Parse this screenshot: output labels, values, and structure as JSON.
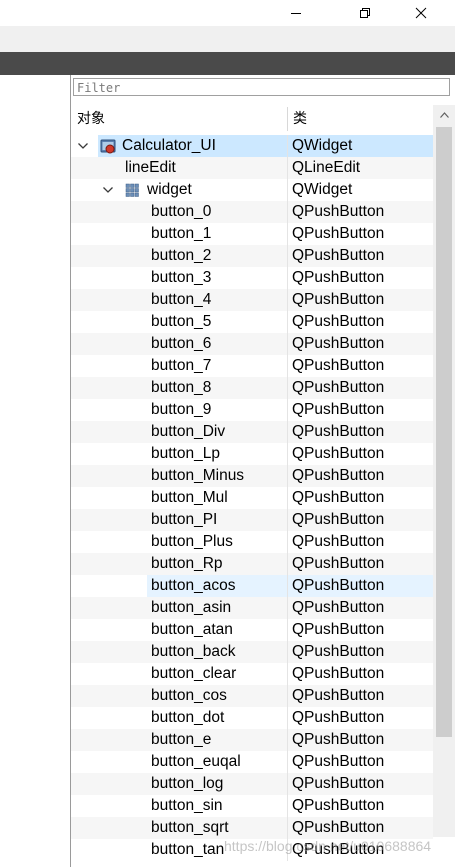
{
  "window": {
    "minimize_icon": "minimize-icon",
    "maximize_icon": "restore-icon",
    "close_icon": "close-icon"
  },
  "filter": {
    "placeholder": "Filter"
  },
  "tree": {
    "header": {
      "object": "对象",
      "class": "类"
    },
    "rows": [
      {
        "name": "Calculator_UI",
        "cls": "QWidget",
        "level": 0,
        "expanded": true,
        "icon": "widget-form-icon",
        "state": "selected"
      },
      {
        "name": "lineEdit",
        "cls": "QLineEdit",
        "level": 1
      },
      {
        "name": "widget",
        "cls": "QWidget",
        "level": 1,
        "expanded": true,
        "icon": "grid-layout-icon"
      },
      {
        "name": "button_0",
        "cls": "QPushButton",
        "level": 2
      },
      {
        "name": "button_1",
        "cls": "QPushButton",
        "level": 2
      },
      {
        "name": "button_2",
        "cls": "QPushButton",
        "level": 2
      },
      {
        "name": "button_3",
        "cls": "QPushButton",
        "level": 2
      },
      {
        "name": "button_4",
        "cls": "QPushButton",
        "level": 2
      },
      {
        "name": "button_5",
        "cls": "QPushButton",
        "level": 2
      },
      {
        "name": "button_6",
        "cls": "QPushButton",
        "level": 2
      },
      {
        "name": "button_7",
        "cls": "QPushButton",
        "level": 2
      },
      {
        "name": "button_8",
        "cls": "QPushButton",
        "level": 2
      },
      {
        "name": "button_9",
        "cls": "QPushButton",
        "level": 2
      },
      {
        "name": "button_Div",
        "cls": "QPushButton",
        "level": 2
      },
      {
        "name": "button_Lp",
        "cls": "QPushButton",
        "level": 2
      },
      {
        "name": "button_Minus",
        "cls": "QPushButton",
        "level": 2
      },
      {
        "name": "button_Mul",
        "cls": "QPushButton",
        "level": 2
      },
      {
        "name": "button_PI",
        "cls": "QPushButton",
        "level": 2
      },
      {
        "name": "button_Plus",
        "cls": "QPushButton",
        "level": 2
      },
      {
        "name": "button_Rp",
        "cls": "QPushButton",
        "level": 2
      },
      {
        "name": "button_acos",
        "cls": "QPushButton",
        "level": 2,
        "state": "hover"
      },
      {
        "name": "button_asin",
        "cls": "QPushButton",
        "level": 2
      },
      {
        "name": "button_atan",
        "cls": "QPushButton",
        "level": 2
      },
      {
        "name": "button_back",
        "cls": "QPushButton",
        "level": 2
      },
      {
        "name": "button_clear",
        "cls": "QPushButton",
        "level": 2
      },
      {
        "name": "button_cos",
        "cls": "QPushButton",
        "level": 2
      },
      {
        "name": "button_dot",
        "cls": "QPushButton",
        "level": 2
      },
      {
        "name": "button_e",
        "cls": "QPushButton",
        "level": 2
      },
      {
        "name": "button_euqal",
        "cls": "QPushButton",
        "level": 2
      },
      {
        "name": "button_log",
        "cls": "QPushButton",
        "level": 2
      },
      {
        "name": "button_sin",
        "cls": "QPushButton",
        "level": 2
      },
      {
        "name": "button_sqrt",
        "cls": "QPushButton",
        "level": 2
      },
      {
        "name": "button_tan",
        "cls": "QPushButton",
        "level": 2
      }
    ]
  },
  "watermark": "https://blog.csdn.net/u010688864",
  "colors": {
    "selection": "#cce8ff",
    "hover": "#e5f3ff",
    "dark_strip": "#4a4a4a"
  }
}
